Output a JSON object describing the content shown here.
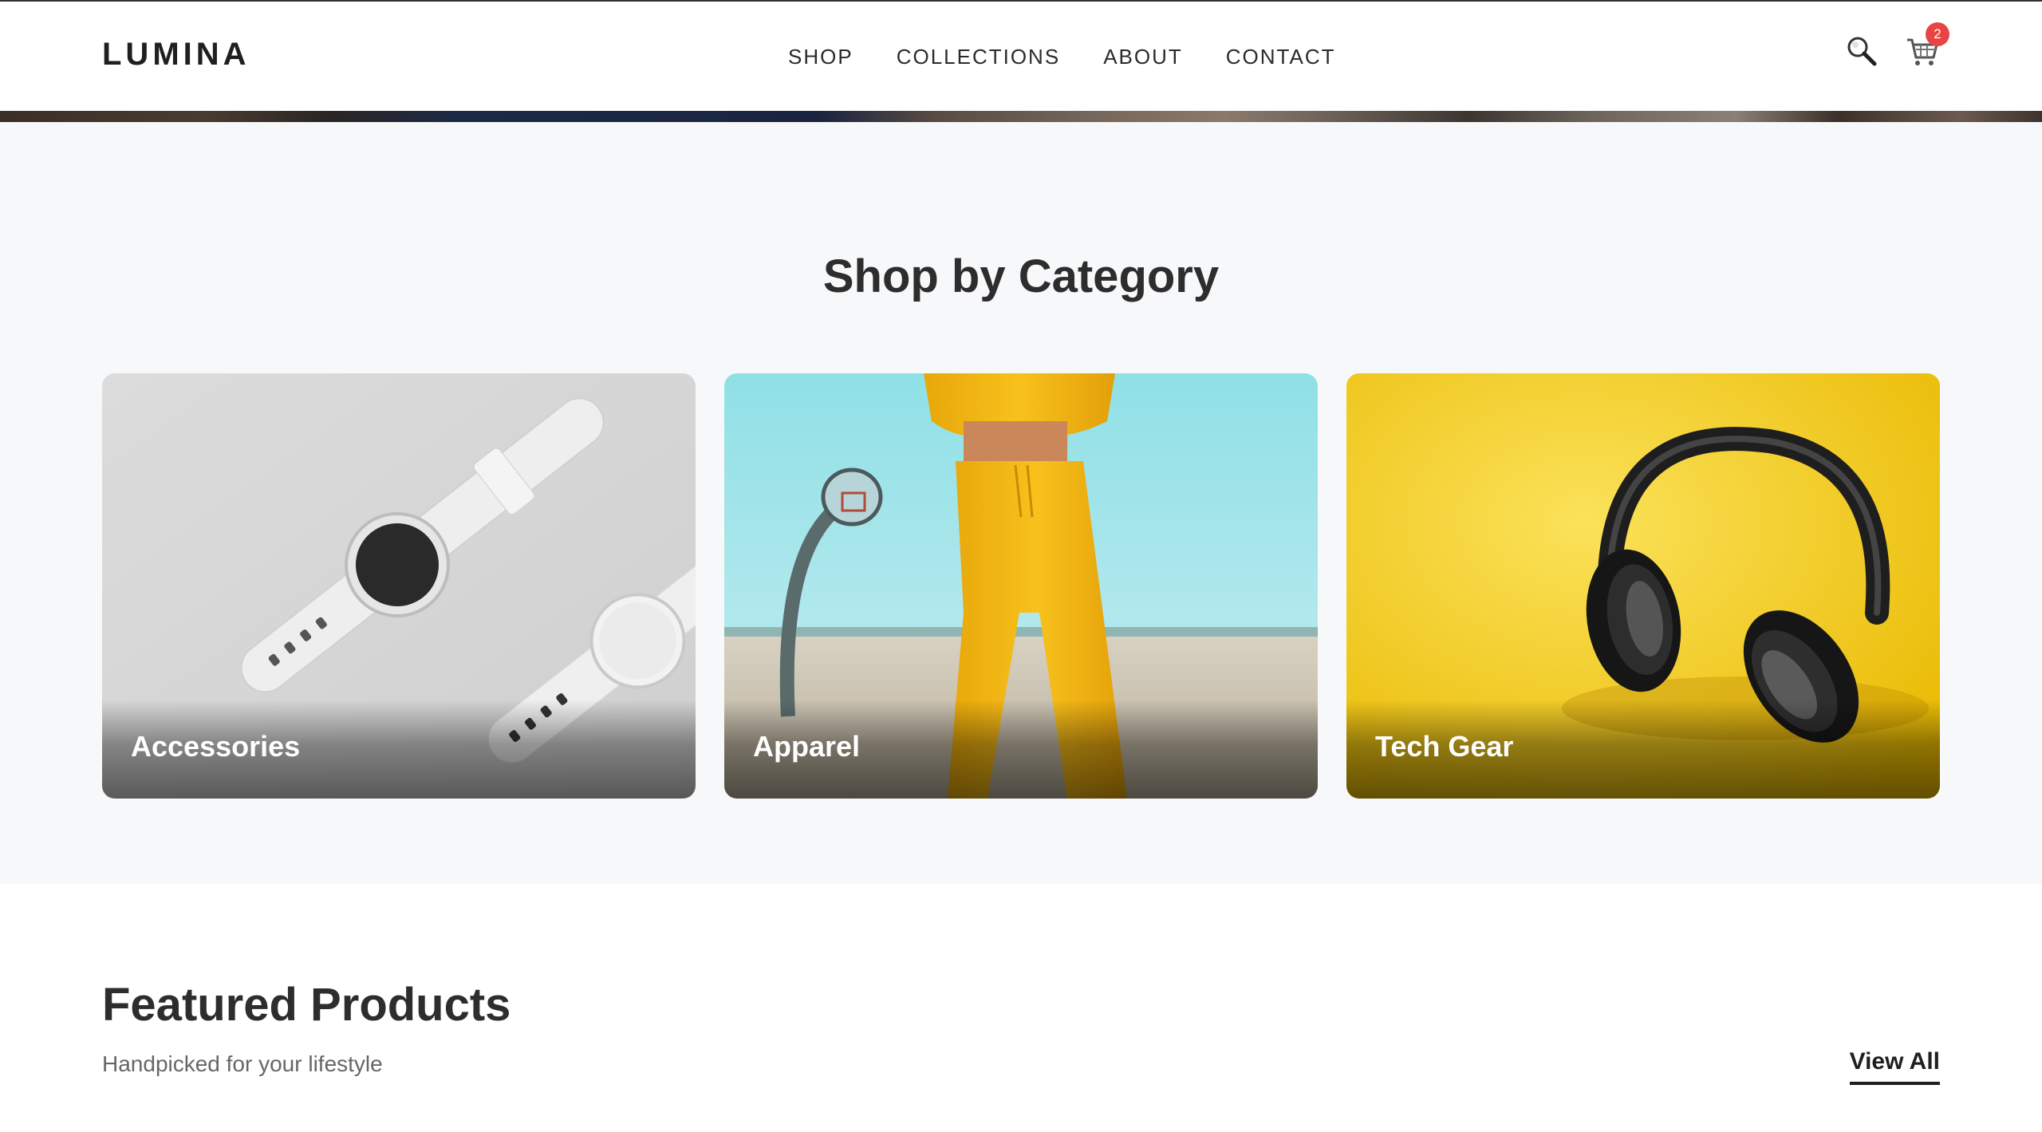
{
  "brand": {
    "logo": "LUMINA"
  },
  "nav": {
    "items": [
      {
        "label": "SHOP"
      },
      {
        "label": "COLLECTIONS"
      },
      {
        "label": "ABOUT"
      },
      {
        "label": "CONTACT"
      }
    ]
  },
  "header_icons": {
    "search": "search-icon",
    "cart": "cart-icon",
    "cart_count": "2"
  },
  "categories": {
    "title": "Shop by Category",
    "items": [
      {
        "label": "Accessories",
        "image": "smartwatches"
      },
      {
        "label": "Apparel",
        "image": "yellow-outfit-basketball-court"
      },
      {
        "label": "Tech Gear",
        "image": "headphones-on-yellow"
      }
    ]
  },
  "featured": {
    "title": "Featured Products",
    "subtitle": "Handpicked for your lifestyle",
    "view_all": "View All"
  },
  "colors": {
    "accent": "#e94444",
    "section_bg": "#f7f8fa",
    "text": "#2d2d2d",
    "muted": "#666666"
  }
}
